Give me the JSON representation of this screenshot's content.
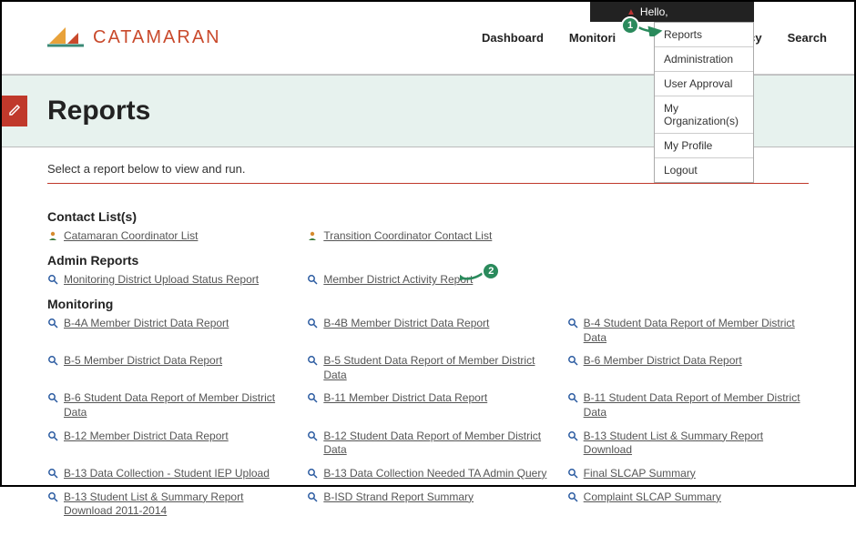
{
  "topbar": {
    "greeting": "Hello,"
  },
  "brand": {
    "name": "CATAMARAN"
  },
  "nav": {
    "dashboard": "Dashboard",
    "monitoring": "Monitori",
    "cy": "cy",
    "search": "Search"
  },
  "dropdown": {
    "items": [
      "Reports",
      "Administration",
      "User Approval",
      "My Organization(s)",
      "My Profile",
      "Logout"
    ]
  },
  "badges": {
    "b1": "1",
    "b2": "2"
  },
  "page": {
    "title": "Reports",
    "instruction": "Select a report below to view and run."
  },
  "sections": {
    "contact": {
      "title": "Contact List(s)",
      "items": [
        "Catamaran Coordinator List",
        "Transition Coordinator Contact List"
      ]
    },
    "admin": {
      "title": "Admin Reports",
      "items": [
        "Monitoring District Upload Status Report",
        "Member District Activity Report"
      ]
    },
    "monitoring": {
      "title": "Monitoring",
      "items": [
        "B-4A Member District Data Report",
        "B-4B Member District Data Report",
        "B-4 Student Data Report of Member District Data",
        "B-5 Member District Data Report",
        "B-5 Student Data Report of Member District Data",
        "B-6 Member District Data Report",
        "B-6 Student Data Report of Member District Data",
        "B-11 Member District Data Report",
        "B-11 Student Data Report of Member District Data",
        "B-12 Member District Data Report",
        "B-12 Student Data Report of Member District Data",
        "B-13 Student List & Summary Report Download",
        "B-13 Data Collection - Student IEP Upload",
        "B-13 Data Collection Needed TA Admin Query",
        "Final SLCAP Summary",
        "B-13 Student List & Summary Report Download 2011-2014",
        "B-ISD Strand Report Summary",
        "Complaint SLCAP Summary"
      ]
    }
  }
}
